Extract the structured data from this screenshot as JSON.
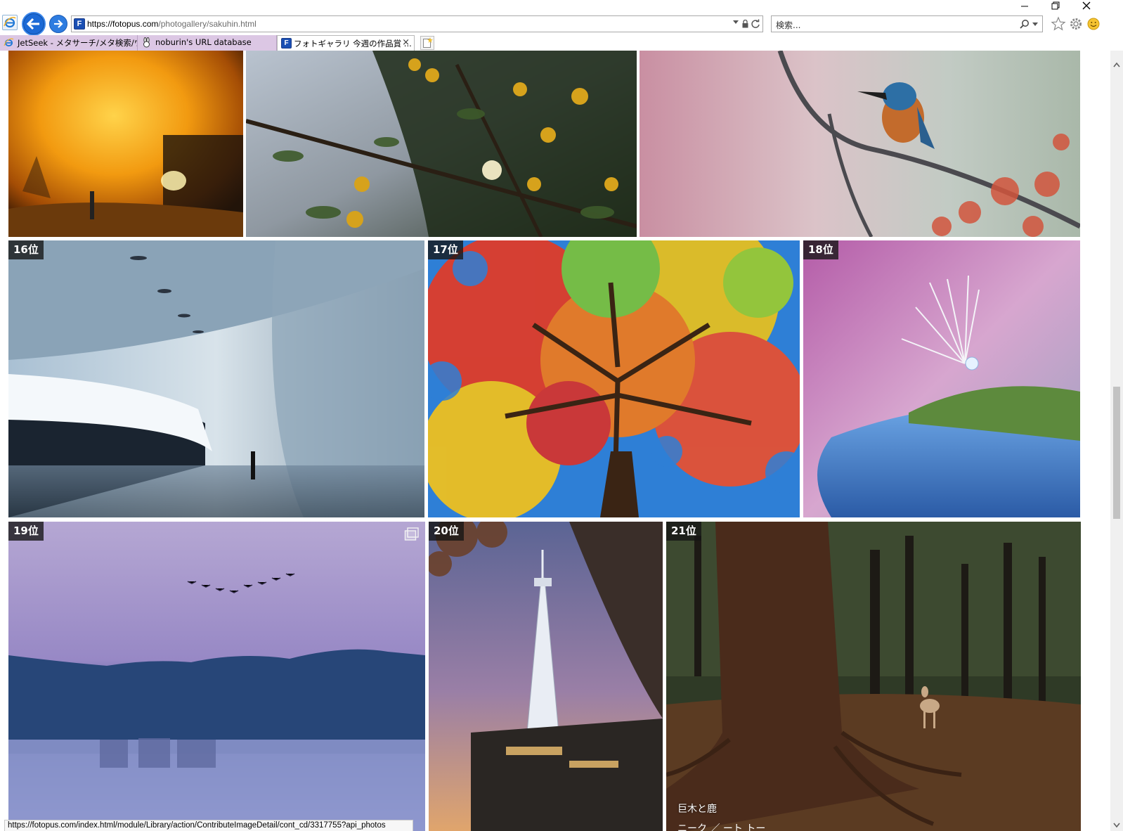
{
  "browser": {
    "url_host": "https://fotopus.com",
    "url_path": "/photogallery/sakuhin.html",
    "search_placeholder": "検索...",
    "tabs": [
      {
        "label": "JetSeek - メタサーチ/メタ検索/ウェ...",
        "active": false
      },
      {
        "label": "noburin's URL database",
        "active": false
      },
      {
        "label": "フォトギャラリ 今週の作品賞 ...",
        "active": true,
        "close": "×"
      }
    ],
    "status_url": "https://fotopus.com/index.html/module/Library/action/ContributeImageDetail/cont_cd/3317755?api_photos"
  },
  "gallery": {
    "row_top": [
      {
        "id": "ginkgo",
        "rank": ""
      },
      {
        "id": "yuzu",
        "rank": ""
      },
      {
        "id": "kingfisher",
        "rank": ""
      }
    ],
    "row_mid": [
      {
        "id": "tunnel",
        "rank": "16位"
      },
      {
        "id": "autumn-tree",
        "rank": "17位"
      },
      {
        "id": "seed-droplet",
        "rank": "18位"
      }
    ],
    "row_bottom": [
      {
        "id": "lake-mist",
        "rank": "19位",
        "multi_icon": "stack-icon"
      },
      {
        "id": "skytree",
        "rank": "20位"
      },
      {
        "id": "deer-cedar",
        "rank": "21位",
        "title": "巨木と鹿",
        "subtitle": "ニーク ／ ート トー"
      }
    ]
  },
  "colors": {
    "tab_inactive": "#dcc7e4",
    "ie_blue": "#1c6ad6",
    "rank_badge": "#141414"
  }
}
